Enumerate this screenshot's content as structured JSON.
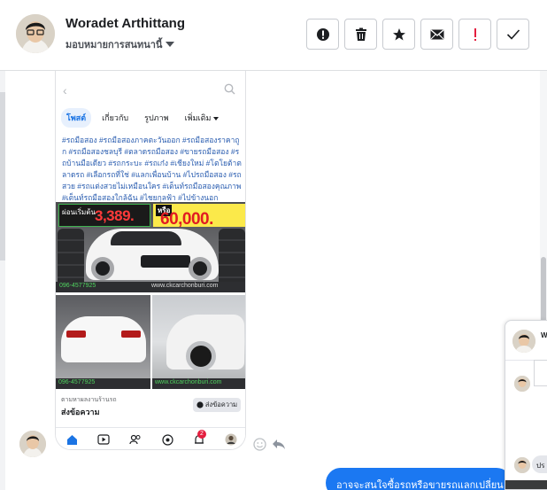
{
  "header": {
    "contact_name": "Woradet Arthittang",
    "assign_label": "มอบหมายการสนทนานี้"
  },
  "toolbar": {
    "buttons": [
      {
        "name": "mark-spam",
        "icon": "alert-circle-icon"
      },
      {
        "name": "delete",
        "icon": "trash-icon"
      },
      {
        "name": "star",
        "icon": "star-icon"
      },
      {
        "name": "mark-unread",
        "icon": "envelope-icon"
      },
      {
        "name": "flag-important",
        "icon": "exclamation-icon"
      },
      {
        "name": "mark-done",
        "icon": "checkmark-icon"
      }
    ]
  },
  "shared_post": {
    "tabs": [
      "โพสต์",
      "เกี่ยวกับ",
      "รูปภาพ",
      "เพิ่มเติม"
    ],
    "active_tab": "โพสต์",
    "hashtags": "#รถมือสอง #รถมือสองภาคตะวันออก #รถมือสองราคาถูก #รถมือสองชลบุรี #ตลาดรถมือสอง #ขายรถมือสอง #รถบ้านมือเดียว #รถกระบะ #รถเก๋ง #เชียงใหม่ #โตโยต้าตลาดรถ #เลือกรถที่ใช่ #แลกเพื่อนบ้าน #ไปรถมือสอง #รถสวย #รถแต่งสวยไม่เหมือนใคร #เต็นท์รถมือสองคุณภาพ #เต็นท์รถมือสองใกล้ฉัน #ไชยกุลฟ้า #ไปข้างนอก",
    "promo_left_label": "ผ่อนเริ่มต้น",
    "promo_left_amount": "3,389.",
    "promo_right_label": "หรือ",
    "promo_right_amount": "60,000.",
    "watermark": "www.ckcarchonburi.com",
    "phone_watermark": "096-4577925",
    "page_info": "ตามหาผลงานร้านรถ",
    "cta_text": "ส่งข้อความ",
    "message_button": "ส่งข้อความ",
    "nav_icons": [
      "home-icon",
      "video-icon",
      "friends-icon",
      "marketplace-icon",
      "bell-icon",
      "profile-icon"
    ],
    "notification_count": "2"
  },
  "outgoing_message": "อาจจะสนใจซื้อรถหรือขายรถแลกเปลี่ยน",
  "mini_chat": {
    "header_initial": "W",
    "bubble_text": "ปร"
  },
  "colors": {
    "accent": "#1b74e4",
    "bubble": "#1b78f2",
    "important": "#e41e3f"
  }
}
